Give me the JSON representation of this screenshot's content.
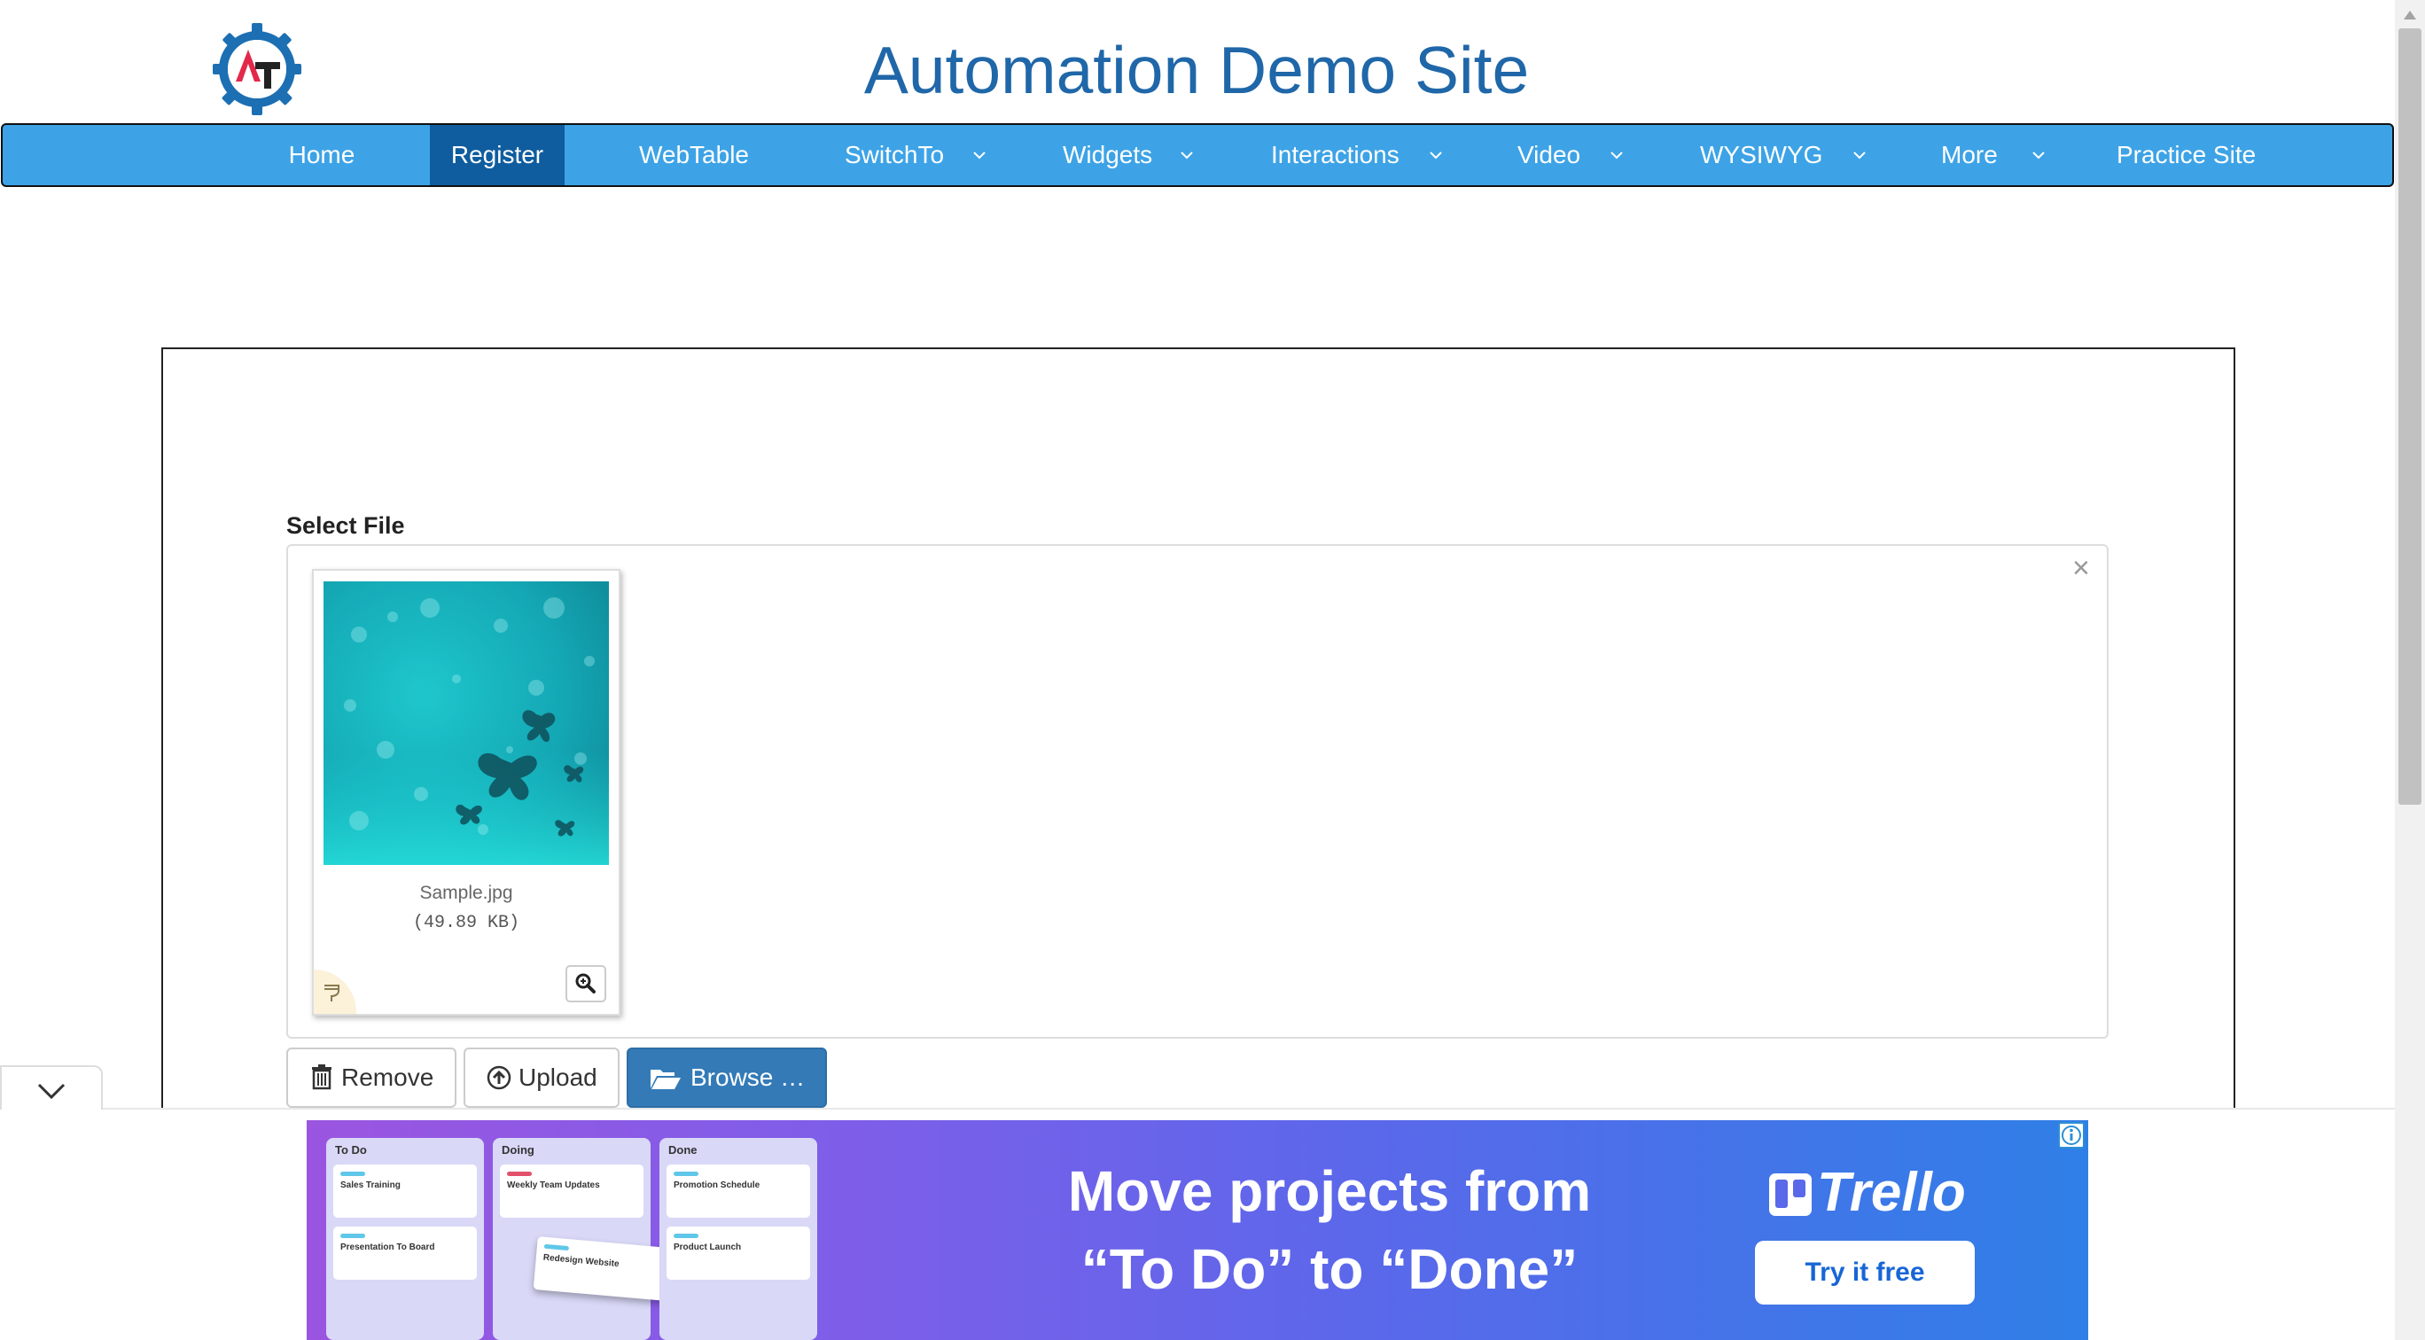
{
  "header": {
    "site_title": "Automation Demo Site",
    "logo_letters": "AT"
  },
  "nav": {
    "items": [
      {
        "label": "Home",
        "dropdown": false
      },
      {
        "label": "Register",
        "dropdown": false,
        "active": true
      },
      {
        "label": "WebTable",
        "dropdown": false
      },
      {
        "label": "SwitchTo",
        "dropdown": true
      },
      {
        "label": "Widgets",
        "dropdown": true
      },
      {
        "label": "Interactions",
        "dropdown": true
      },
      {
        "label": "Video",
        "dropdown": true
      },
      {
        "label": "WYSIWYG",
        "dropdown": true
      },
      {
        "label": "More",
        "dropdown": true
      },
      {
        "label": "Practice Site",
        "dropdown": false
      }
    ]
  },
  "upload": {
    "label": "Select File",
    "close_symbol": "×",
    "file": {
      "name": "Sample.jpg",
      "size": "(49.89 KB)"
    },
    "buttons": {
      "remove": "Remove",
      "upload": "Upload",
      "browse": "Browse …"
    }
  },
  "ad": {
    "headline_line1": "Move projects from",
    "headline_line2": "“To Do” to “Done”",
    "brand": "Trello",
    "cta": "Try it free",
    "board_columns": [
      "To Do",
      "Doing",
      "Done"
    ],
    "board_cards": [
      "Sales Training",
      "Presentation To Board",
      "Weekly Team Updates",
      "Redesign Website",
      "Promotion Schedule",
      "Product Launch"
    ]
  },
  "colors": {
    "nav_bg": "#3da3e6",
    "nav_active": "#0f5d9f",
    "title": "#1f67a8",
    "browse_btn": "#337ab7"
  }
}
